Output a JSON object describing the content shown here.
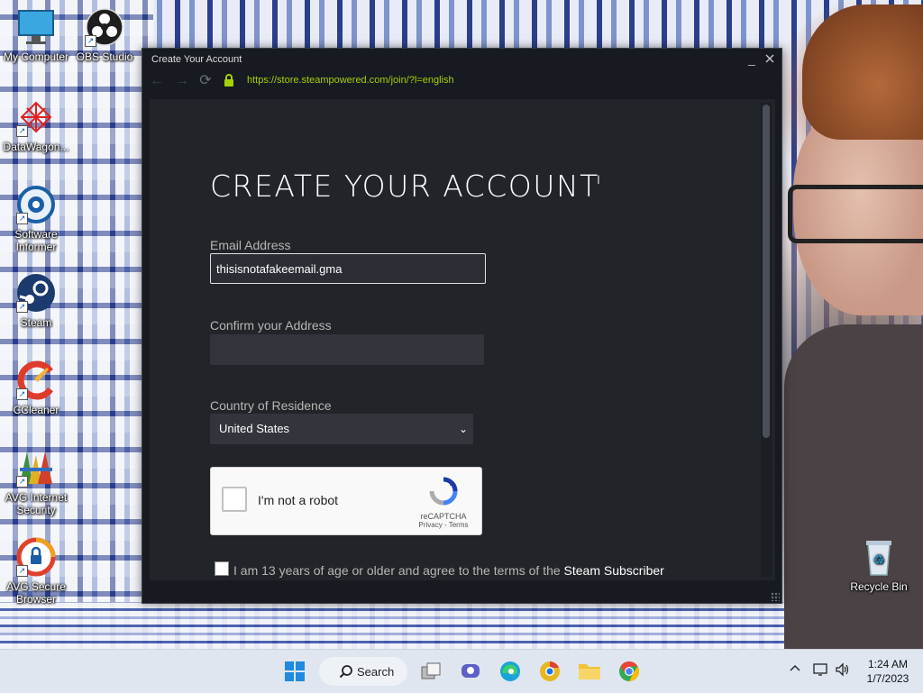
{
  "desktop": {
    "icons": [
      {
        "label": "My Computer"
      },
      {
        "label": "OBS Studio"
      },
      {
        "label": "DataWagon..."
      },
      {
        "label": "Software Informer"
      },
      {
        "label": "Steam"
      },
      {
        "label": "CCleaner"
      },
      {
        "label": "AVG Internet Security"
      },
      {
        "label": "AVG Secure Browser"
      },
      {
        "label": "Recycle Bin"
      }
    ]
  },
  "window": {
    "title": "Create Your Account",
    "url": "https://store.steampowered.com/join/?l=english",
    "accent_url_color": "#a4d007"
  },
  "form": {
    "heading": "CREATE YOUR ACCOUNT",
    "email_label": "Email Address",
    "email_value": "thisisnotafakeemail.gma",
    "confirm_label": "Confirm your Address",
    "confirm_value": "",
    "country_label": "Country of Residence",
    "country_value": "United States",
    "captcha_label": "I'm not a robot",
    "captcha_brand": "reCAPTCHA",
    "captcha_links": "Privacy - Terms",
    "agree_text": "I am 13 years of age or older and agree to the terms of the ",
    "agree_link": "Steam Subscriber"
  },
  "taskbar": {
    "search_label": "Search",
    "time": "1:24 AM",
    "date": "1/7/2023"
  }
}
